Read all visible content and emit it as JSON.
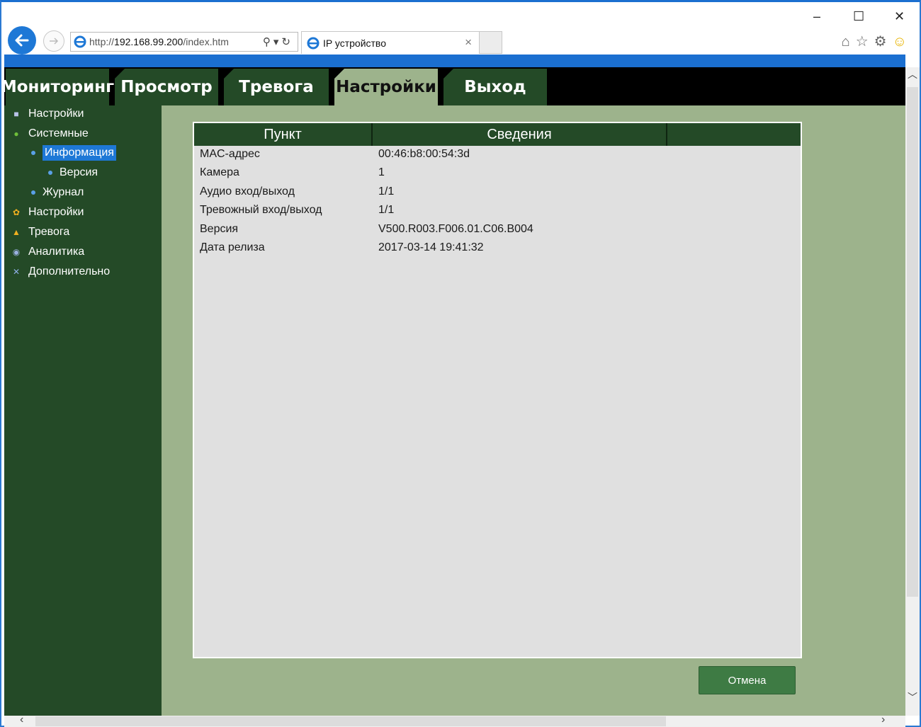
{
  "browser": {
    "url_prefix": "http://",
    "url_host": "192.168.99.200",
    "url_path": "/index.htm",
    "tab_title": "IP устройство",
    "minimize": "–",
    "maximize": "☐",
    "close": "✕"
  },
  "topnav": {
    "tabs": [
      {
        "label": "Мониторинг"
      },
      {
        "label": "Просмотр"
      },
      {
        "label": "Тревога"
      },
      {
        "label": "Настройки"
      },
      {
        "label": "Выход"
      }
    ],
    "active_index": 3
  },
  "sidebar": {
    "items": [
      {
        "label": "Настройки",
        "icon": "settings-book-icon",
        "glyph": "■"
      },
      {
        "label": "Системные",
        "icon": "info-circle-icon",
        "glyph": "●"
      },
      {
        "label": "Информация",
        "icon": "bullet",
        "level": 1,
        "selected": true
      },
      {
        "label": "Версия",
        "icon": "bullet",
        "level": 2
      },
      {
        "label": "Журнал",
        "icon": "bullet",
        "level": 1
      },
      {
        "label": "Настройки",
        "icon": "gear-icon",
        "glyph": "✿"
      },
      {
        "label": "Тревога",
        "icon": "bell-icon",
        "glyph": "▲"
      },
      {
        "label": "Аналитика",
        "icon": "globe-icon",
        "glyph": "◉"
      },
      {
        "label": "Дополнительно",
        "icon": "tools-icon",
        "glyph": "✕"
      }
    ]
  },
  "table": {
    "headers": [
      "Пункт",
      "Сведения",
      ""
    ],
    "rows": [
      {
        "item": "MAC-адрес",
        "value": "00:46:b8:00:54:3d"
      },
      {
        "item": "Камера",
        "value": "1"
      },
      {
        "item": "Аудио вход/выход",
        "value": "1/1"
      },
      {
        "item": "Тревожный вход/выход",
        "value": "1/1"
      },
      {
        "item": "Версия",
        "value": "V500.R003.F006.01.C06.B004"
      },
      {
        "item": "Дата релиза",
        "value": "2017-03-14 19:41:32"
      }
    ]
  },
  "buttons": {
    "cancel": "Отмена"
  },
  "colors": {
    "nav_bg": "#244a27",
    "page_bg": "#9db38c",
    "panel_bg": "#e0e0e0",
    "selection": "#1e78d6",
    "browser_accent": "#1b6fd0"
  }
}
